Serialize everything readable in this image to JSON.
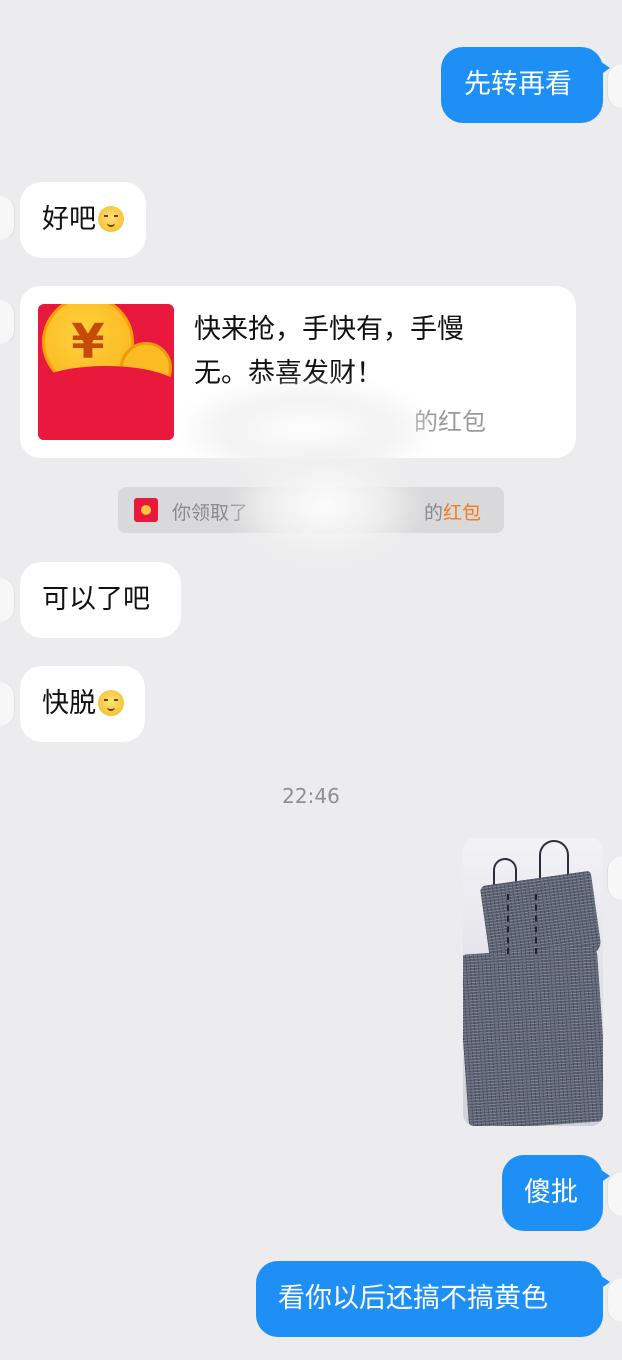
{
  "colors": {
    "background": "#ececee",
    "outgoing_bubble": "#1e90f5",
    "incoming_bubble": "#ffffff",
    "red_packet": "#e8193c",
    "link_orange": "#f47a1c"
  },
  "messages": [
    {
      "id": "m1",
      "direction": "out",
      "type": "text",
      "text": "先转再看"
    },
    {
      "id": "m2",
      "direction": "in",
      "type": "text",
      "text": "好吧",
      "emoji": "wry-smile-emoji"
    },
    {
      "id": "m3",
      "direction": "in",
      "type": "red_packet",
      "text": "快来抢，手快有，手慢无。恭喜发财！",
      "sender_suffix": "的红包",
      "icon": "red-packet-icon"
    },
    {
      "id": "m5",
      "direction": "in",
      "type": "text",
      "text": "可以了吧"
    },
    {
      "id": "m6",
      "direction": "in",
      "type": "text",
      "text": "快脱",
      "emoji": "shy-smile-emoji"
    },
    {
      "id": "m7",
      "direction": "out",
      "type": "image",
      "description_icon": "clothing-photo"
    },
    {
      "id": "m8",
      "direction": "out",
      "type": "text",
      "text": "傻批"
    },
    {
      "id": "m9",
      "direction": "out",
      "type": "text",
      "text": "看你以后还搞不搞黄色"
    }
  ],
  "system_notice": {
    "prefix": "你领取了",
    "middle": "的",
    "link": "红包",
    "icon": "red-packet-small-icon"
  },
  "timestamp": "22:46"
}
